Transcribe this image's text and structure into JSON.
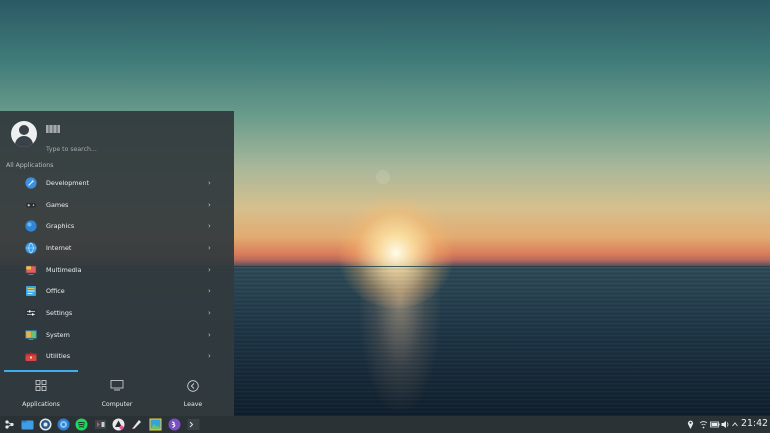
{
  "menu": {
    "search_placeholder": "Type to search...",
    "section_title": "All Applications",
    "categories": [
      {
        "label": "Development",
        "icon": "development-icon"
      },
      {
        "label": "Games",
        "icon": "games-icon"
      },
      {
        "label": "Graphics",
        "icon": "graphics-icon"
      },
      {
        "label": "Internet",
        "icon": "internet-icon"
      },
      {
        "label": "Multimedia",
        "icon": "multimedia-icon"
      },
      {
        "label": "Office",
        "icon": "office-icon"
      },
      {
        "label": "Settings",
        "icon": "settings-icon"
      },
      {
        "label": "System",
        "icon": "system-icon"
      },
      {
        "label": "Utilities",
        "icon": "utilities-icon"
      }
    ],
    "chevron": "›",
    "tabs": [
      {
        "label": "Applications",
        "icon": "grid-icon",
        "active": true
      },
      {
        "label": "Computer",
        "icon": "monitor-icon"
      },
      {
        "label": "Leave",
        "icon": "arrow-left-circle-icon"
      }
    ]
  },
  "taskbar": {
    "clock": "21:42",
    "launchers": [
      "app-launcher-icon",
      "file-manager-icon",
      "steam-icon",
      "browser-icon",
      "spotify-icon",
      "media-icon",
      "inkscape-icon",
      "krita-icon",
      "image-viewer-icon",
      "emacs-icon",
      "terminal-icon"
    ],
    "tray": [
      "location-icon",
      "network-icon",
      "battery-icon",
      "volume-icon",
      "expand-tray-icon"
    ]
  },
  "colors": {
    "accent": "#3daee9",
    "menu_bg": "#323a3e",
    "taskbar_bg": "#2b3236"
  }
}
